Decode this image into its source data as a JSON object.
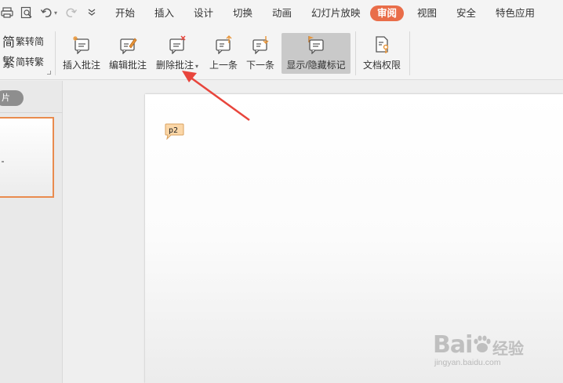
{
  "menubar": {
    "tabs": [
      "开始",
      "插入",
      "设计",
      "切换",
      "动画",
      "幻灯片放映",
      "审阅",
      "视图",
      "安全",
      "特色应用"
    ],
    "active_tab": "审阅"
  },
  "ribbon": {
    "chinese_conversion": {
      "traditional_to_simplified": "繁转简",
      "simplified_to_traditional": "简转繁"
    },
    "comments": {
      "insert": "插入批注",
      "edit": "编辑批注",
      "delete": "删除批注",
      "previous": "上一条",
      "next": "下一条",
      "show_hide": "显示/隐藏标记"
    },
    "document_permissions": "文档权限"
  },
  "slide_panel": {
    "pill_label": "片"
  },
  "slide": {
    "comment_marker": "p2"
  },
  "watermark": {
    "logo_left": "Bai",
    "logo_right": "经验",
    "url": "jingyan.baidu.com"
  },
  "colors": {
    "active_tab": "#e96d49",
    "thumbnail_border": "#e98b4e",
    "annotation_arrow": "#e8453c",
    "comment_marker_fill": "#fbd7a8"
  },
  "icons": [
    "print-icon",
    "print-preview-icon",
    "undo-icon",
    "redo-icon",
    "more-icon",
    "insert-comment-icon",
    "edit-comment-icon",
    "delete-comment-icon",
    "previous-comment-icon",
    "next-comment-icon",
    "show-markup-icon",
    "document-permission-icon"
  ]
}
